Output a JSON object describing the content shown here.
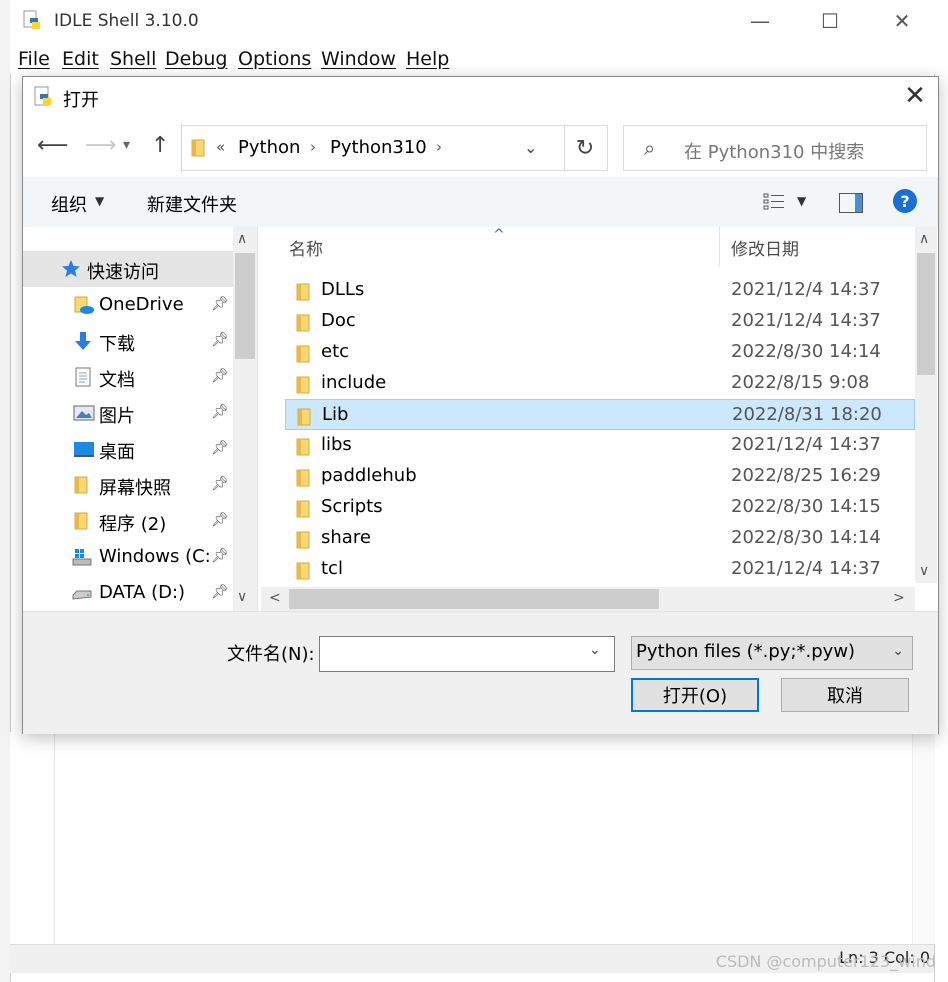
{
  "idle": {
    "title": "IDLE Shell 3.10.0",
    "menus": [
      "File",
      "Edit",
      "Shell",
      "Debug",
      "Options",
      "Window",
      "Help"
    ],
    "status": "Ln: 3  Col: 0",
    "watermark": "CSDN @computer123_wind"
  },
  "dialog": {
    "title": "打开",
    "address": {
      "overflow": "«",
      "segments": [
        "Python",
        "Python310"
      ]
    },
    "search_placeholder": "在 Python310 中搜索",
    "toolbar": {
      "organize": "组织",
      "new_folder": "新建文件夹",
      "help": "?"
    },
    "nav": [
      {
        "label": "快速访问",
        "icon": "star-icon",
        "selected": true
      },
      {
        "label": "OneDrive",
        "icon": "onedrive-icon",
        "pinned": true
      },
      {
        "label": "下载",
        "icon": "download-icon",
        "pinned": true
      },
      {
        "label": "文档",
        "icon": "document-icon",
        "pinned": true
      },
      {
        "label": "图片",
        "icon": "picture-icon",
        "pinned": true
      },
      {
        "label": "桌面",
        "icon": "desktop-icon",
        "pinned": true
      },
      {
        "label": "屏幕快照",
        "icon": "folder-icon",
        "pinned": true
      },
      {
        "label": "程序 (2)",
        "icon": "folder-icon",
        "pinned": true
      },
      {
        "label": "Windows (C:",
        "icon": "windows-drive-icon",
        "pinned": true
      },
      {
        "label": "DATA (D:)",
        "icon": "drive-icon",
        "pinned": true
      }
    ],
    "columns": {
      "name": "名称",
      "date": "修改日期"
    },
    "files": [
      {
        "name": "DLLs",
        "date": "2021/12/4 14:37"
      },
      {
        "name": "Doc",
        "date": "2021/12/4 14:37"
      },
      {
        "name": "etc",
        "date": "2022/8/30 14:14"
      },
      {
        "name": "include",
        "date": "2022/8/15 9:08"
      },
      {
        "name": "Lib",
        "date": "2022/8/31 18:20",
        "selected": true
      },
      {
        "name": "libs",
        "date": "2021/12/4 14:37"
      },
      {
        "name": "paddlehub",
        "date": "2022/8/25 16:29"
      },
      {
        "name": "Scripts",
        "date": "2022/8/30 14:15"
      },
      {
        "name": "share",
        "date": "2022/8/30 14:14"
      },
      {
        "name": "tcl",
        "date": "2021/12/4 14:37"
      }
    ],
    "filename_label": "文件名(N):",
    "filename_value": "",
    "filetype": "Python files (*.py;*.pyw)",
    "open_button": "打开(O)",
    "cancel_button": "取消"
  },
  "colors": {
    "accent": "#0078d7",
    "selection": "#cce8ff",
    "folder": "#f8d775"
  }
}
